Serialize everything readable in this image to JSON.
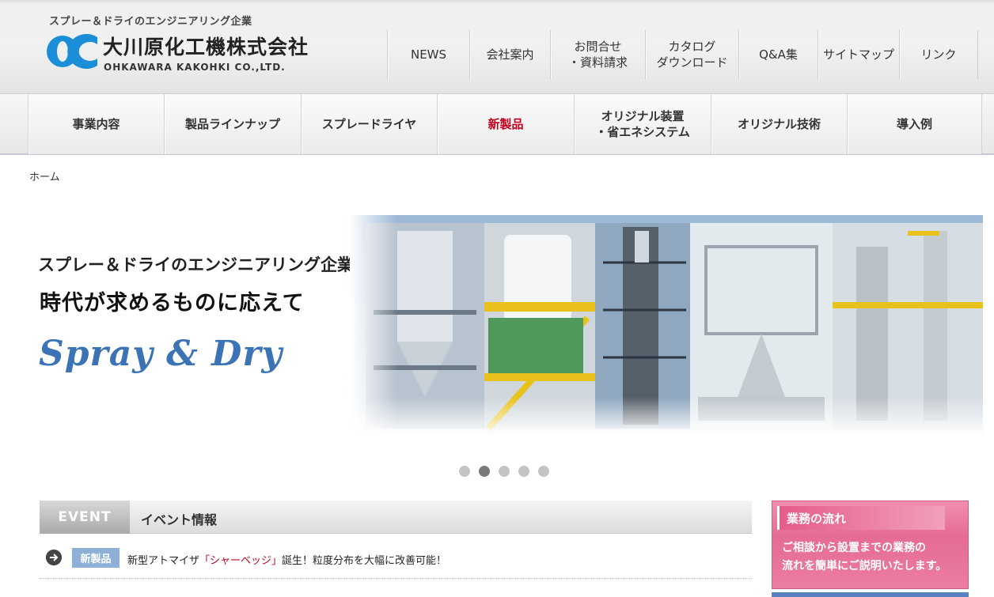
{
  "header": {
    "tagline": "スプレー＆ドライのエンジニアリング企業",
    "company_ja": "大川原化工機株式会社",
    "company_en": "OHKAWARA KAKOHKI CO.,LTD."
  },
  "topnav": [
    {
      "label": "NEWS"
    },
    {
      "label": "会社案内"
    },
    {
      "label": "お問合せ\n・資料請求"
    },
    {
      "label": "カタログ\nダウンロード"
    },
    {
      "label": "Q&A集"
    },
    {
      "label": "サイトマップ"
    },
    {
      "label": "リンク"
    }
  ],
  "mainnav": [
    {
      "label": "事業内容"
    },
    {
      "label": "製品ラインナップ"
    },
    {
      "label": "スプレードライヤ"
    },
    {
      "label": "新製品",
      "active": true
    },
    {
      "label": "オリジナル装置\n・省エネシステム"
    },
    {
      "label": "オリジナル技術"
    },
    {
      "label": "導入例"
    }
  ],
  "breadcrumb": "ホーム",
  "hero": {
    "line1": "スプレー＆ドライのエンジニアリング企業",
    "line2": "時代が求めるものに応えて",
    "line3": "Spray & Dry",
    "slides": 5,
    "active_slide": 2
  },
  "event": {
    "label": "EVENT",
    "title": "イベント情報",
    "items": [
      {
        "badge": "新製品",
        "text_before": "新型アトマイザ",
        "highlight": "「シャーベッジ」",
        "text_after": "誕生！粒度分布を大幅に改善可能！"
      }
    ]
  },
  "side_banner": {
    "title": "業務の流れ",
    "body": "ご相談から設置までの業務の\n流れを簡単にご説明いたします。"
  },
  "colors": {
    "accent_red": "#c0001e",
    "logo_blue": "#1a8fd8",
    "hero_blue": "#3b73b5",
    "banner_pink": "#e56b92"
  }
}
